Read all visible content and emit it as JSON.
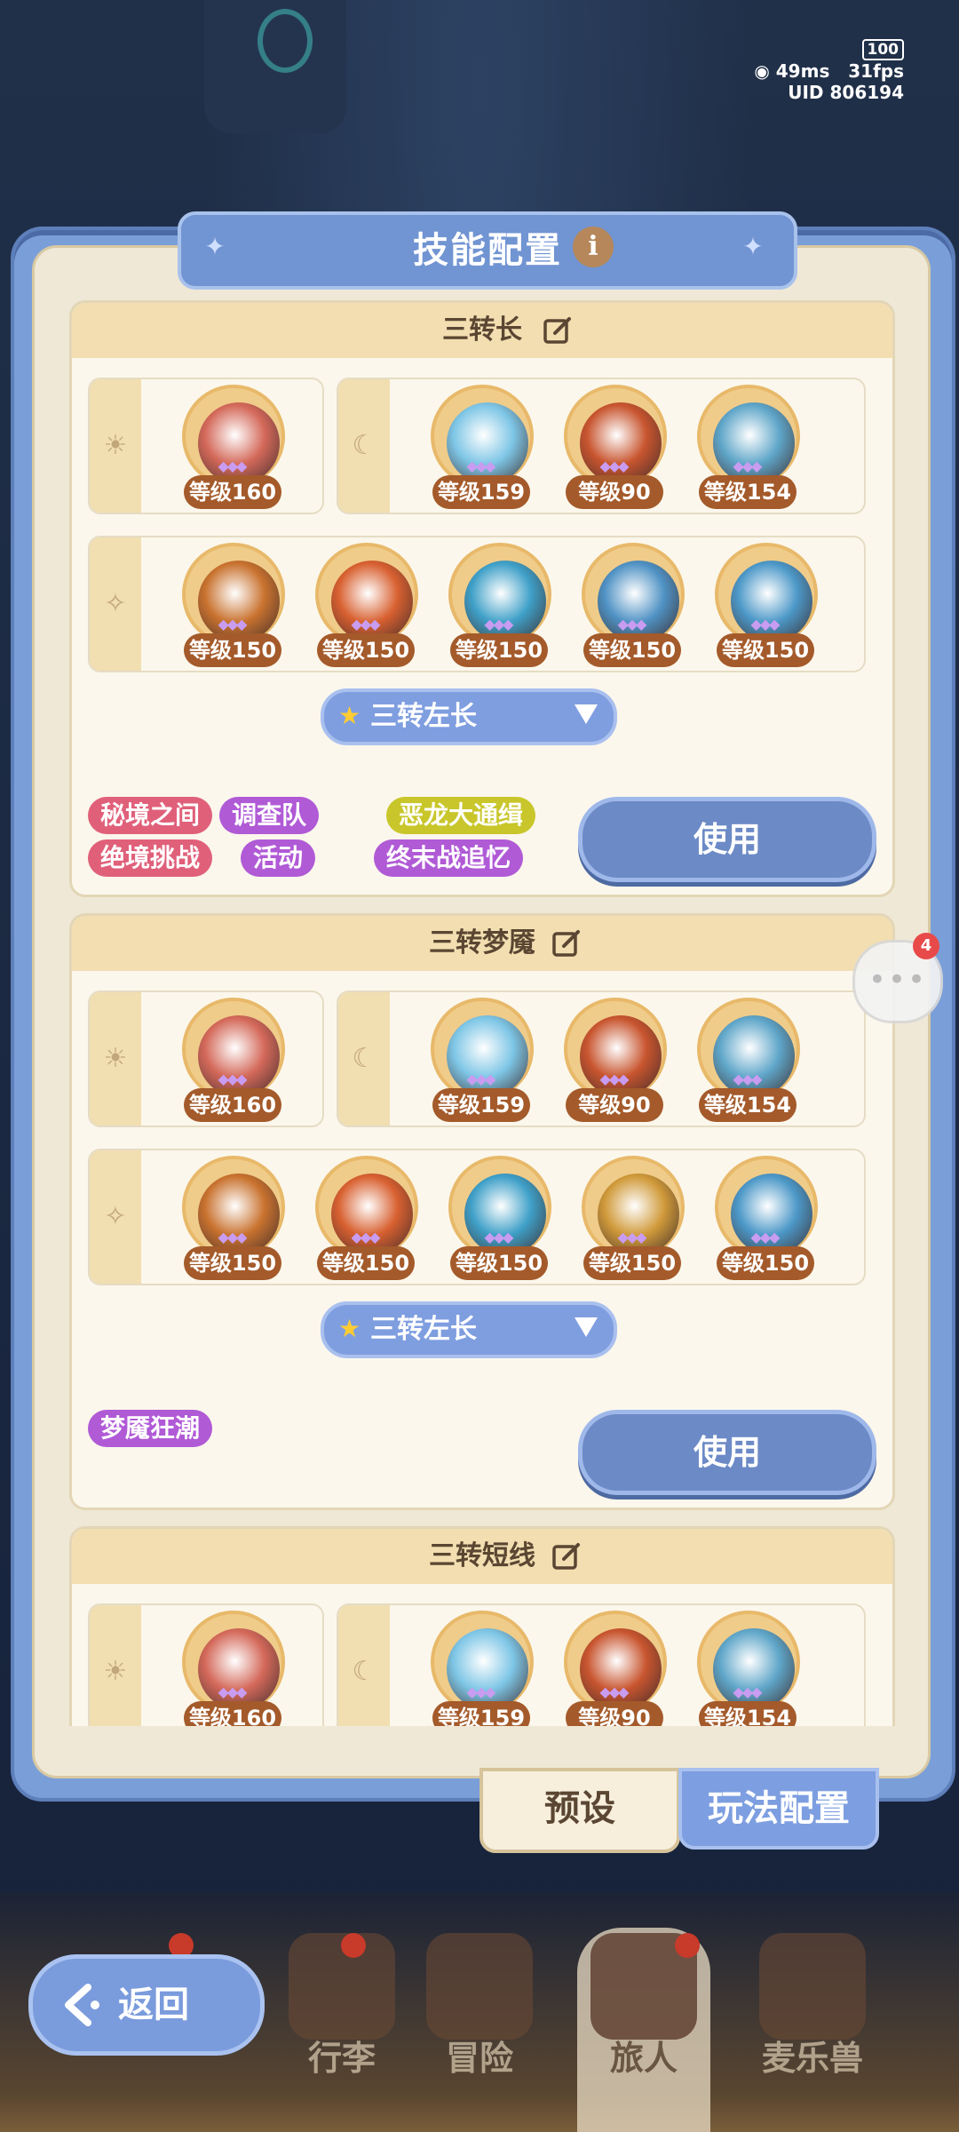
{
  "status": {
    "battery": "100",
    "ping": "49ms",
    "fps": "31fps",
    "uid": "UID 806194"
  },
  "title": "技能配置",
  "configs": [
    {
      "name": "三转长",
      "selector": "三转左长",
      "use_label": "使用",
      "tags": [
        {
          "label": "秘境之间",
          "color": "#e0607a"
        },
        {
          "label": "调查队",
          "color": "#b05ad6"
        },
        {
          "label": "恶龙大通缉",
          "color": "#c8c62a"
        },
        {
          "label": "绝境挑战",
          "color": "#e0607a"
        },
        {
          "label": "活动",
          "color": "#b05ad6"
        },
        {
          "label": "终末战追忆",
          "color": "#b05ad6"
        }
      ],
      "sun_skills": [
        {
          "level": "等级160",
          "color": "#d4695a"
        }
      ],
      "moon_skills": [
        {
          "level": "等级159",
          "color": "#7ec6e6"
        },
        {
          "level": "等级90",
          "color": "#c8552f"
        },
        {
          "level": "等级154",
          "color": "#5fa6c9"
        }
      ],
      "spark_skills": [
        {
          "level": "等级150",
          "color": "#c9722f"
        },
        {
          "level": "等级150",
          "color": "#d86030"
        },
        {
          "level": "等级150",
          "color": "#3fa0c8"
        },
        {
          "level": "等级150",
          "color": "#4f92c4"
        },
        {
          "level": "等级150",
          "color": "#4c98c8"
        }
      ]
    },
    {
      "name": "三转梦魇",
      "selector": "三转左长",
      "use_label": "使用",
      "tags": [
        {
          "label": "梦魇狂潮",
          "color": "#b05ad6"
        }
      ],
      "sun_skills": [
        {
          "level": "等级160",
          "color": "#d4695a"
        }
      ],
      "moon_skills": [
        {
          "level": "等级159",
          "color": "#7ec6e6"
        },
        {
          "level": "等级90",
          "color": "#c8552f"
        },
        {
          "level": "等级154",
          "color": "#5fa6c9"
        }
      ],
      "spark_skills": [
        {
          "level": "等级150",
          "color": "#c9722f"
        },
        {
          "level": "等级150",
          "color": "#d86030"
        },
        {
          "level": "等级150",
          "color": "#3fa0c8"
        },
        {
          "level": "等级150",
          "color": "#d09a3a"
        },
        {
          "level": "等级150",
          "color": "#4c98c8"
        }
      ]
    },
    {
      "name": "三转短线",
      "sun_skills": [
        {
          "level": "等级160",
          "color": "#d4695a"
        }
      ],
      "moon_skills": [
        {
          "level": "等级159",
          "color": "#7ec6e6"
        },
        {
          "level": "等级90",
          "color": "#c8552f"
        },
        {
          "level": "等级154",
          "color": "#5fa6c9"
        }
      ]
    }
  ],
  "tabs": {
    "preset": "预设",
    "gameplay": "玩法配置"
  },
  "chat_badge": "4",
  "back_label": "返回",
  "nav": [
    "行李",
    "冒险",
    "旅人",
    "麦乐兽"
  ]
}
